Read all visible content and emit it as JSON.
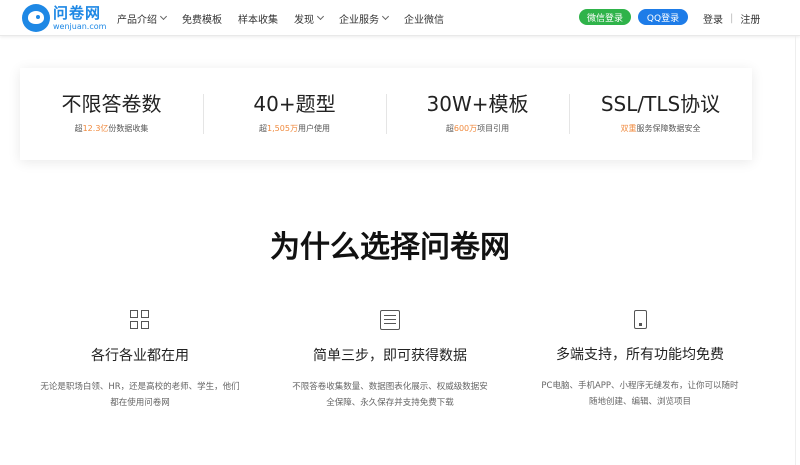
{
  "header": {
    "logo_cn": "问卷网",
    "logo_en": "wenjuan.com",
    "nav": [
      {
        "label": "产品介绍",
        "dropdown": true
      },
      {
        "label": "免费模板",
        "dropdown": false
      },
      {
        "label": "样本收集",
        "dropdown": false
      },
      {
        "label": "发现",
        "dropdown": true
      },
      {
        "label": "企业服务",
        "dropdown": true
      },
      {
        "label": "企业微信",
        "dropdown": false
      }
    ],
    "wechat_login": "微信登录",
    "qq_login": "QQ登录",
    "login": "登录",
    "separator": "|",
    "register": "注册"
  },
  "stats": [
    {
      "title": "不限答卷数",
      "pre": "超",
      "highlight": "12.3亿",
      "post": "份数据收集"
    },
    {
      "title": "40+题型",
      "pre": "超",
      "highlight": "1,505万",
      "post": "用户使用"
    },
    {
      "title": "30W+模板",
      "pre": "超",
      "highlight": "600万",
      "post": "项目引用"
    },
    {
      "title": "SSL/TLS协议",
      "pre": "",
      "highlight": "双重",
      "post": "服务保障数据安全"
    }
  ],
  "why": {
    "title": "为什么选择问卷网"
  },
  "features": [
    {
      "icon": "grid-icon",
      "title": "各行各业都在用",
      "desc": "无论是职场白领、HR，还是高校的老师、学生，他们都在使用问卷网"
    },
    {
      "icon": "list-icon",
      "title": "简单三步，即可获得数据",
      "desc": "不限答卷收集数量、数据图表化展示、权威级数据安全保障、永久保存并支持免费下载"
    },
    {
      "icon": "device-icon",
      "title": "多端支持，所有功能均免费",
      "desc": "PC电脑、手机APP、小程序无缝发布，让你可以随时随地创建、编辑、浏览项目"
    }
  ],
  "colors": {
    "brand": "#1e88e5",
    "wechat": "#2fb34a",
    "qq": "#1e7ce8",
    "highlight": "#f08a3e"
  }
}
